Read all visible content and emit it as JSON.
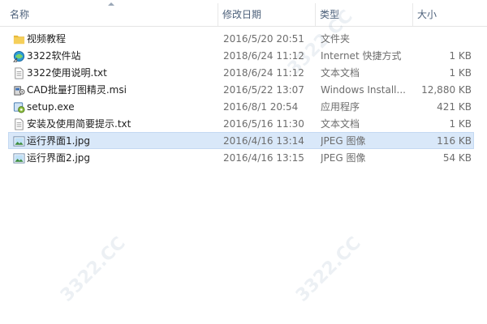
{
  "columns": {
    "name": "名称",
    "date": "修改日期",
    "type": "类型",
    "size": "大小"
  },
  "files": [
    {
      "name": "视频教程",
      "date": "2016/5/20 20:51",
      "type": "文件夹",
      "size": "",
      "icon": "folder-icon"
    },
    {
      "name": "3322软件站",
      "date": "2018/6/24 11:12",
      "type": "Internet 快捷方式",
      "size": "1 KB",
      "icon": "internet-shortcut-icon"
    },
    {
      "name": "3322使用说明.txt",
      "date": "2018/6/24 11:12",
      "type": "文本文档",
      "size": "1 KB",
      "icon": "text-file-icon"
    },
    {
      "name": "CAD批量打图精灵.msi",
      "date": "2016/5/22 13:07",
      "type": "Windows Install...",
      "size": "12,880 KB",
      "icon": "installer-icon"
    },
    {
      "name": "setup.exe",
      "date": "2016/8/1 20:54",
      "type": "应用程序",
      "size": "421 KB",
      "icon": "setup-exe-icon"
    },
    {
      "name": "安装及使用简要提示.txt",
      "date": "2016/5/16 11:30",
      "type": "文本文档",
      "size": "1 KB",
      "icon": "text-file-icon"
    },
    {
      "name": "运行界面1.jpg",
      "date": "2016/4/16 13:14",
      "type": "JPEG 图像",
      "size": "116 KB",
      "icon": "image-file-icon",
      "selected": true
    },
    {
      "name": "运行界面2.jpg",
      "date": "2016/4/16 13:15",
      "type": "JPEG 图像",
      "size": "54 KB",
      "icon": "image-file-icon"
    }
  ],
  "watermark": "3322.CC",
  "colors": {
    "header_text": "#4c607a",
    "selection": "#d9e8f9",
    "selection_border": "#c4d9f2"
  }
}
